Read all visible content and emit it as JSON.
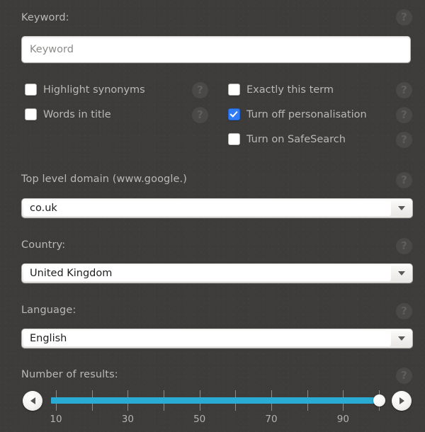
{
  "colors": {
    "background": "#3d3c3b",
    "label_text": "#bab8b5",
    "checkbox_checked": "#2f7cf6",
    "slider_fill": "#29abd4",
    "help_icon_bg": "#4a4948"
  },
  "help_glyph": "?",
  "keyword": {
    "label": "Keyword:",
    "value": "",
    "placeholder": "Keyword",
    "help": "?"
  },
  "options": {
    "left_column": [
      {
        "label": "Highlight synonyms",
        "checked": false,
        "help": "?"
      },
      {
        "label": "Words in title",
        "checked": false,
        "help": "?"
      }
    ],
    "right_column": [
      {
        "label": "Exactly this term",
        "checked": false,
        "help": "?"
      },
      {
        "label": "Turn off personalisation",
        "checked": true,
        "help": "?"
      },
      {
        "label": "Turn on SafeSearch",
        "checked": false,
        "help": "?"
      }
    ]
  },
  "tld": {
    "label": "Top level domain (www.google.)",
    "selected": "co.uk",
    "help": "?"
  },
  "country": {
    "label": "Country:",
    "selected": "United Kingdom",
    "help": "?"
  },
  "language": {
    "label": "Language:",
    "selected": "English",
    "help": "?"
  },
  "results": {
    "label": "Number of results:",
    "help": "?",
    "min": 10,
    "max": 100,
    "value": 100,
    "tick_values": [
      10,
      20,
      30,
      40,
      50,
      60,
      70,
      80,
      90,
      100
    ],
    "tick_labels": [
      {
        "value": 10,
        "text": "10"
      },
      {
        "value": 30,
        "text": "30"
      },
      {
        "value": 50,
        "text": "50"
      },
      {
        "value": 70,
        "text": "70"
      },
      {
        "value": 90,
        "text": "90"
      }
    ],
    "decrement_icon": "triangle-left",
    "increment_icon": "triangle-right"
  }
}
